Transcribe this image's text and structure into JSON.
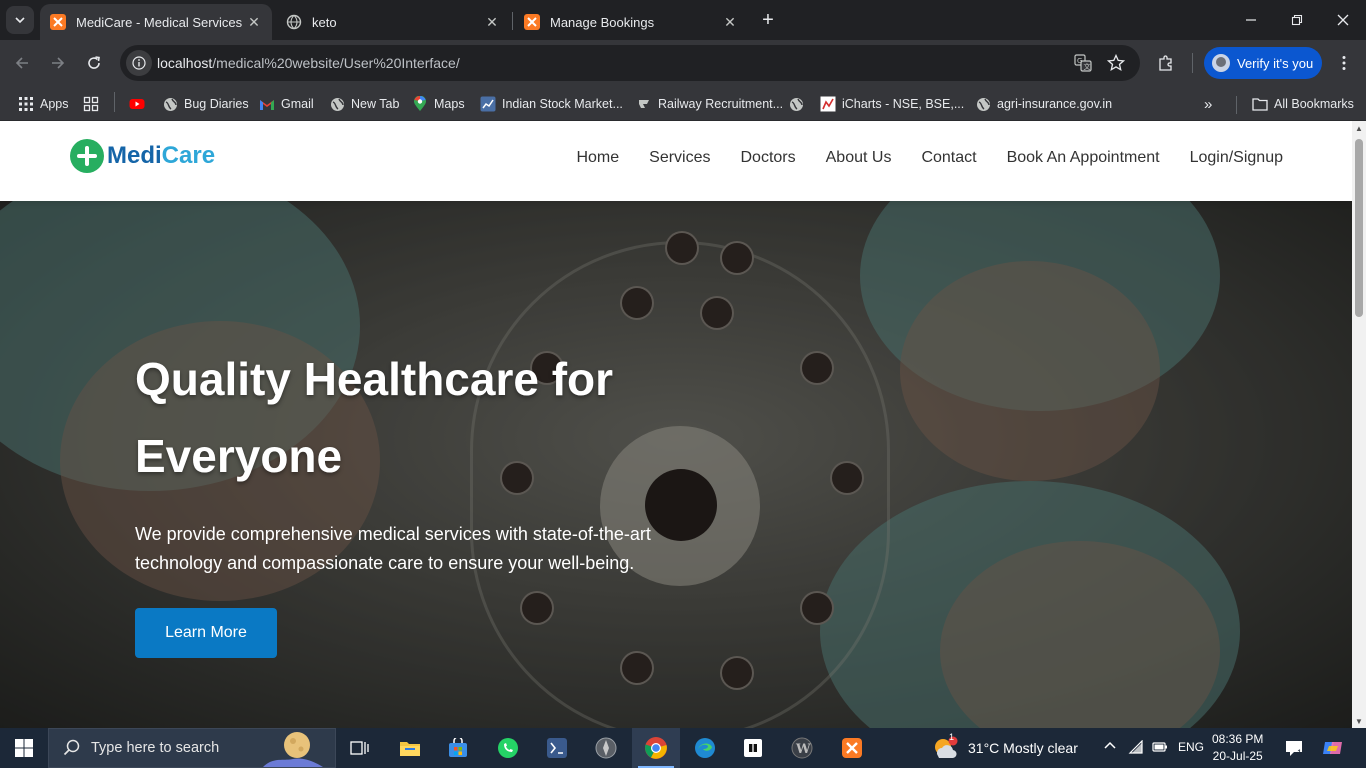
{
  "browser": {
    "tabs": [
      {
        "title": "MediCare - Medical Services",
        "favicon": "xampp-icon",
        "active": true
      },
      {
        "title": "keto",
        "favicon": "globe-icon",
        "active": false
      },
      {
        "title": "Manage Bookings",
        "favicon": "xampp-icon",
        "active": false
      }
    ],
    "address": {
      "host": "localhost",
      "path": "/medical%20website/User%20Interface/"
    },
    "verify_label": "Verify it's you",
    "bookmarks": [
      {
        "label": "Apps",
        "icon": "apps-grid-icon"
      },
      {
        "label": "",
        "icon": "grid-icon"
      },
      {
        "label": "",
        "icon": "youtube-icon"
      },
      {
        "label": "Bug Diaries",
        "icon": "globe-icon"
      },
      {
        "label": "Gmail",
        "icon": "gmail-icon"
      },
      {
        "label": "New Tab",
        "icon": "globe-icon"
      },
      {
        "label": "Maps",
        "icon": "maps-icon"
      },
      {
        "label": "Indian Stock Market...",
        "icon": "chart-icon"
      },
      {
        "label": "Railway Recruitment...",
        "icon": "railway-icon"
      },
      {
        "label": "",
        "icon": "globe-icon"
      },
      {
        "label": "iCharts - NSE, BSE,...",
        "icon": "icharts-icon"
      },
      {
        "label": "agri-insurance.gov.in",
        "icon": "globe-icon"
      }
    ],
    "all_bookmarks": "All Bookmarks"
  },
  "site": {
    "brand_part1": "Medi",
    "brand_part2": "Care",
    "nav": [
      "Home",
      "Services",
      "Doctors",
      "About Us",
      "Contact",
      "Book An Appointment",
      "Login/Signup"
    ],
    "hero": {
      "title_line1": "Quality Healthcare for",
      "title_line2": "Everyone",
      "text": "We provide comprehensive medical services with state-of-the-art technology and compassionate care to ensure your well-being.",
      "button": "Learn More"
    }
  },
  "taskbar": {
    "search_placeholder": "Type here to search",
    "weather": "31°C  Mostly clear",
    "weather_badge": "1",
    "lang": "ENG",
    "time": "08:36 PM",
    "date": "20-Jul-25",
    "notif_count": "1"
  },
  "colors": {
    "accent": "#0a79c4",
    "brand_green": "#27ae60",
    "brand_dark": "#1565a8",
    "brand_light": "#2ea7d8"
  }
}
